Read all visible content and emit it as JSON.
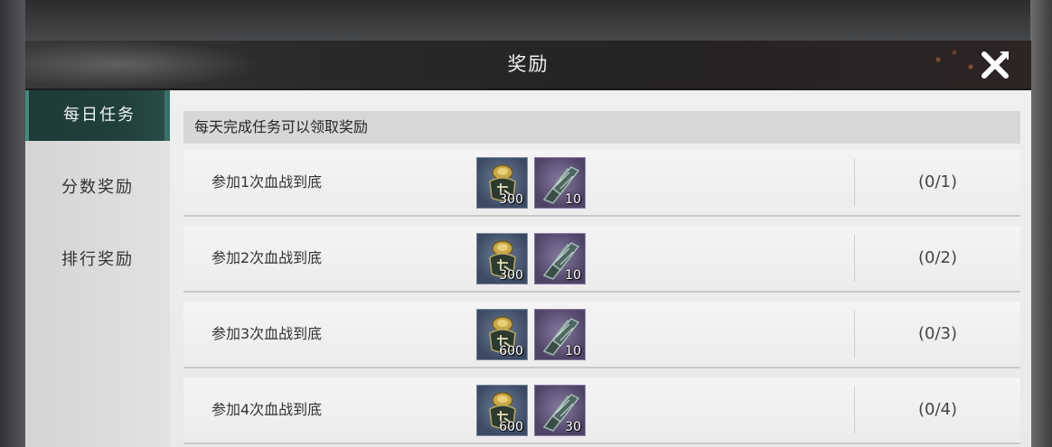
{
  "window": {
    "title": "奖励",
    "close_icon": "close-icon"
  },
  "sidebar": {
    "tabs": [
      {
        "label": "每日任务",
        "active": true
      },
      {
        "label": "分数奖励",
        "active": false
      },
      {
        "label": "排行奖励",
        "active": false
      }
    ]
  },
  "notice": "每天完成任务可以领取奖励",
  "tasks": [
    {
      "label": "参加1次血战到底",
      "rewards": [
        {
          "icon": "coin-pouch-icon",
          "qty": "300"
        },
        {
          "icon": "scroll-icon",
          "qty": "10"
        }
      ],
      "progress": "(0/1)"
    },
    {
      "label": "参加2次血战到底",
      "rewards": [
        {
          "icon": "coin-pouch-icon",
          "qty": "300"
        },
        {
          "icon": "scroll-icon",
          "qty": "10"
        }
      ],
      "progress": "(0/2)"
    },
    {
      "label": "参加3次血战到底",
      "rewards": [
        {
          "icon": "coin-pouch-icon",
          "qty": "600"
        },
        {
          "icon": "scroll-icon",
          "qty": "10"
        }
      ],
      "progress": "(0/3)"
    },
    {
      "label": "参加4次血战到底",
      "rewards": [
        {
          "icon": "coin-pouch-icon",
          "qty": "600"
        },
        {
          "icon": "scroll-icon",
          "qty": "30"
        }
      ],
      "progress": "(0/4)"
    }
  ],
  "colors": {
    "active_tab": "#22413c",
    "panel_bg": "#e6e6e6",
    "header_bg": "#2a2828"
  }
}
